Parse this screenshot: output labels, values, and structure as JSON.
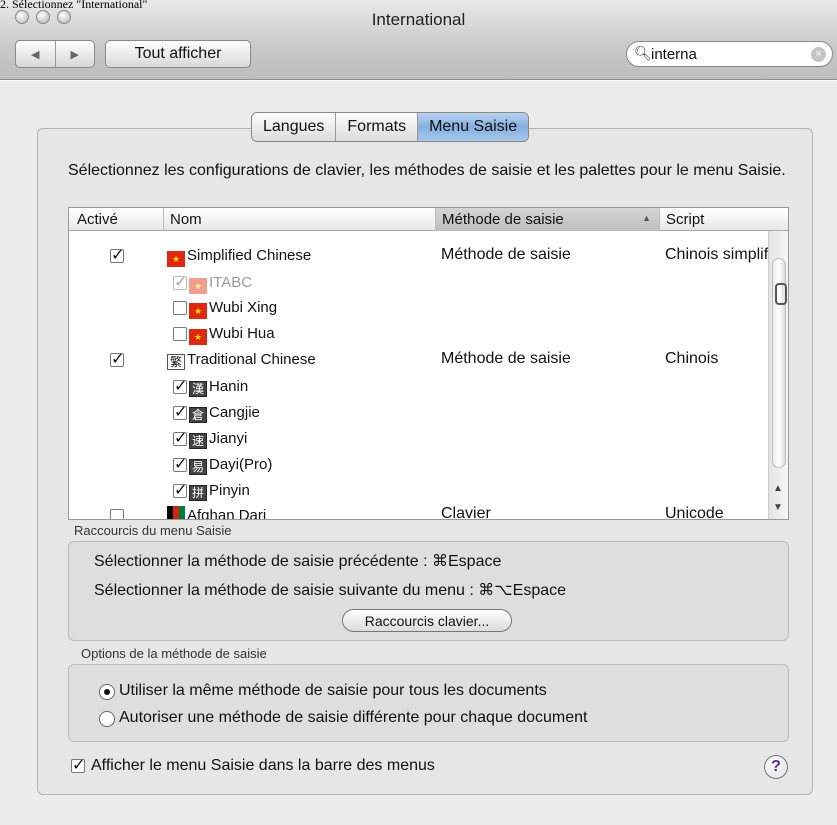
{
  "doc_caption": "2. Sélectionnez \"International\"",
  "window": {
    "title": "International"
  },
  "toolbar": {
    "back_glyph": "◀",
    "forward_glyph": "▶",
    "show_all_label": "Tout afficher",
    "search_value": "interna"
  },
  "tabs": [
    {
      "label": "Langues",
      "active": false
    },
    {
      "label": "Formats",
      "active": false
    },
    {
      "label": "Menu Saisie",
      "active": true
    }
  ],
  "intro_text": "Sélectionnez les configurations de clavier, les méthodes de saisie et les palettes pour le menu Saisie.",
  "table": {
    "columns": {
      "enabled": "Activé",
      "name": "Nom",
      "method": "Méthode de saisie",
      "script": "Script"
    },
    "rows": [
      {
        "name": "Simplified Chinese",
        "icon": "china-flag-icon",
        "method": "Méthode de saisie",
        "script": "Chinois simplifié",
        "checked": true,
        "level": 0
      },
      {
        "name": "ITABC",
        "icon": "itabc-icon",
        "checked": true,
        "disabled": true,
        "level": 1
      },
      {
        "name": "Wubi Xing",
        "icon": "wubi-xing-icon",
        "checked": false,
        "level": 1
      },
      {
        "name": "Wubi Hua",
        "icon": "wubi-hua-icon",
        "checked": false,
        "level": 1
      },
      {
        "name": "Traditional Chinese",
        "icon": "traditional-chinese-icon",
        "glyph": "繁",
        "method": "Méthode de saisie",
        "script": "Chinois",
        "checked": true,
        "level": 0
      },
      {
        "name": "Hanin",
        "icon": "hanin-icon",
        "glyph": "漢",
        "checked": true,
        "level": 1
      },
      {
        "name": "Cangjie",
        "icon": "cangjie-icon",
        "glyph": "倉",
        "checked": true,
        "level": 1
      },
      {
        "name": "Jianyi",
        "icon": "jianyi-icon",
        "glyph": "速",
        "checked": true,
        "level": 1
      },
      {
        "name": "Dayi(Pro)",
        "icon": "dayi-icon",
        "glyph": "易",
        "checked": true,
        "level": 1
      },
      {
        "name": "Pinyin",
        "icon": "pinyin-icon",
        "glyph": "拼",
        "checked": true,
        "level": 1
      },
      {
        "name": "Afghan Dari",
        "icon": "afghanistan-flag-icon",
        "method": "Clavier",
        "script": "Unicode",
        "checked": false,
        "level": 0
      }
    ]
  },
  "shortcuts": {
    "label": "Raccourcis du menu Saisie",
    "previous": "Sélectionner la méthode de saisie précédente : ⌘Espace",
    "next": "Sélectionner la méthode de saisie suivante du menu : ⌘⌥Espace",
    "keyboard_button": "Raccourcis clavier..."
  },
  "options": {
    "label": "Options de la méthode de saisie",
    "same_method": "Utiliser la même méthode de saisie pour tous les documents",
    "per_document": "Autoriser une méthode de saisie différente pour chaque document",
    "selected": "same_method"
  },
  "show_menu": {
    "label": "Afficher le menu Saisie dans la barre des menus",
    "checked": true
  },
  "help_glyph": "?"
}
